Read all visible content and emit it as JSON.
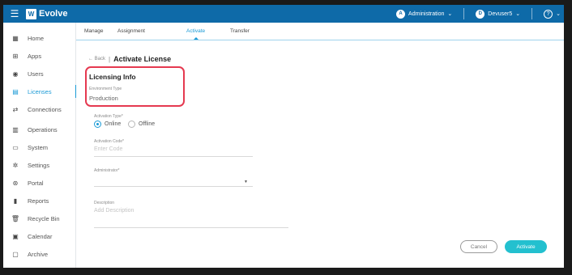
{
  "app": {
    "name": "Evolve",
    "logo_letter": "W"
  },
  "topbar": {
    "tenant": {
      "initial": "A",
      "label": "Administration"
    },
    "user": {
      "initial": "D",
      "label": "Devuser5"
    },
    "help_icon": "?"
  },
  "sidebar": {
    "items": [
      {
        "label": "Home",
        "icon": "grid-icon"
      },
      {
        "label": "Apps",
        "icon": "apps-icon"
      },
      {
        "label": "Users",
        "icon": "user-icon"
      },
      {
        "label": "Licenses",
        "icon": "license-icon"
      },
      {
        "label": "Connections",
        "icon": "connections-icon"
      },
      {
        "label": "Operations",
        "icon": "operations-icon"
      },
      {
        "label": "System",
        "icon": "system-icon"
      },
      {
        "label": "Settings",
        "icon": "settings-icon"
      },
      {
        "label": "Portal",
        "icon": "portal-icon"
      },
      {
        "label": "Reports",
        "icon": "reports-icon"
      },
      {
        "label": "Recycle Bin",
        "icon": "trash-icon"
      },
      {
        "label": "Calendar",
        "icon": "calendar-icon"
      },
      {
        "label": "Archive",
        "icon": "archive-icon"
      }
    ],
    "active_index": 3
  },
  "tabs": [
    {
      "label": "Manage"
    },
    {
      "label": "Assignment"
    },
    {
      "label": "Activate"
    },
    {
      "label": "Transfer"
    }
  ],
  "active_tab": 2,
  "breadcrumb": {
    "back": "← Back",
    "separator": "|",
    "title": "Activate License"
  },
  "licensing": {
    "section_title": "Licensing Info",
    "environment_type_label": "Environment Type",
    "environment_type_value": "Production",
    "activation_type_label": "Activation Type*",
    "activation_options": [
      "Online",
      "Offline"
    ],
    "activation_selected": "Online",
    "activation_code_label": "Activation Code*",
    "activation_code_placeholder": "Enter Code",
    "administrator_label": "Administrator*",
    "administrator_value": "",
    "description_label": "Description",
    "description_placeholder": "Add Description"
  },
  "actions": {
    "cancel": "Cancel",
    "activate": "Activate"
  },
  "colors": {
    "topbar": "#0e6aa8",
    "accent": "#1a9ad6",
    "primary_button": "#23c0cf",
    "highlight": "#e53950"
  }
}
